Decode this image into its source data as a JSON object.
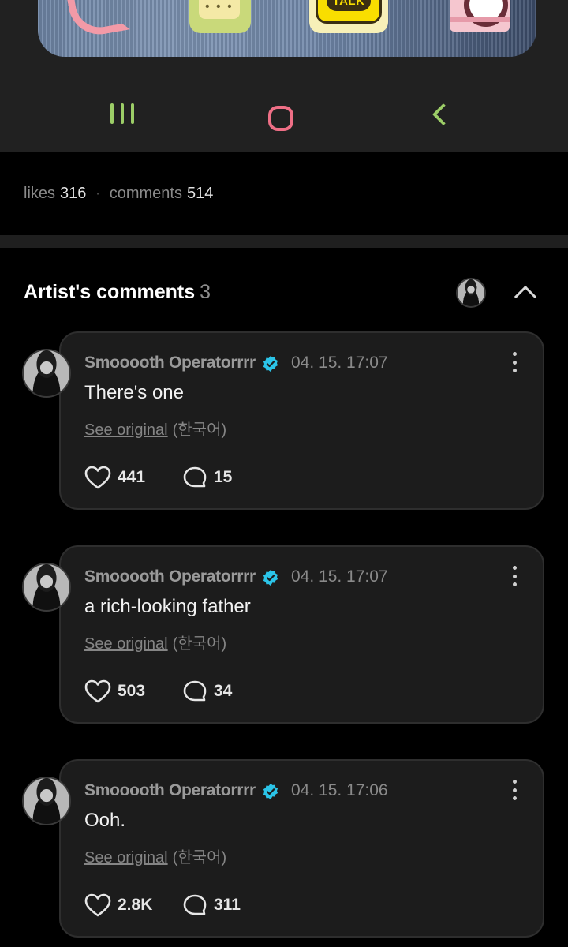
{
  "screenshot": {
    "app_label": "TALK",
    "nav": {
      "recent": "recent-apps",
      "home": "home",
      "back": "back"
    }
  },
  "stats": {
    "likes_label": "likes",
    "likes": "316",
    "comments_label": "comments",
    "comments": "514"
  },
  "artist_comments": {
    "title": "Artist's comments",
    "count": "3",
    "items": [
      {
        "author": "Smooooth Operatorrrr",
        "timestamp": "04. 15. 17:07",
        "text": "There's one",
        "see_original": "See original",
        "language": "(한국어)",
        "likes": "441",
        "replies": "15"
      },
      {
        "author": "Smooooth Operatorrrr",
        "timestamp": "04. 15. 17:07",
        "text": "a rich-looking father",
        "see_original": "See original",
        "language": "(한국어)",
        "likes": "503",
        "replies": "34"
      },
      {
        "author": "Smooooth Operatorrrr",
        "timestamp": "04. 15. 17:06",
        "text": "Ooh.",
        "see_original": "See original",
        "language": "(한국어)",
        "likes": "2.8K",
        "replies": "311"
      }
    ]
  },
  "colors": {
    "background": "#000000",
    "card": "#1c1c1c",
    "verified": "#2bc4e8",
    "nav_green": "#9ccd67",
    "nav_pink": "#ef6f86"
  }
}
